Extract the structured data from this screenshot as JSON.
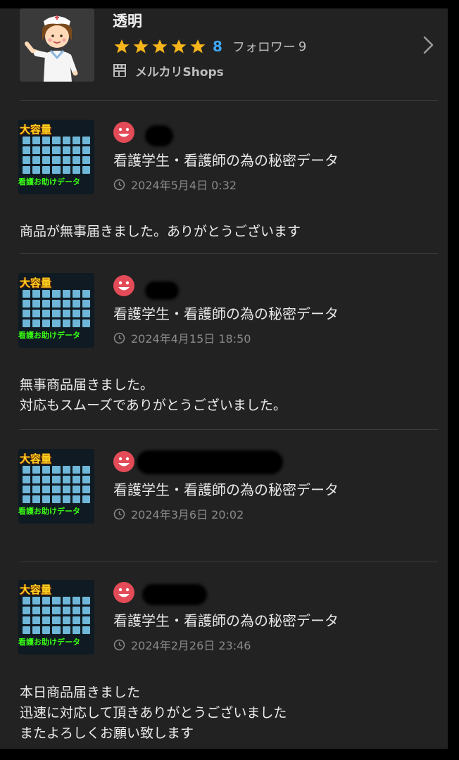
{
  "seller": {
    "name": "透明",
    "rating_count": "8",
    "follower_label": "フォロワー",
    "follower_count": "9",
    "shops_label": "メルカリShops",
    "avatar_icon": "nurse-illustration",
    "star_icon": "star-icon",
    "chevron_icon": "chevron-right-icon"
  },
  "colors": {
    "background": "#222222",
    "accent_blue": "#3da5f4",
    "star_yellow": "#f6b51b",
    "face_red": "#e24b57",
    "thumb_yellow": "#ffd21f",
    "thumb_green": "#39ff14"
  },
  "reviews": [
    {
      "thumb_title": "大容量",
      "thumb_caption": "看護お助けデータ",
      "product_title": "看護学生・看護師の為の秘密データ",
      "date": "2024年5月4日 0:32",
      "comment": [
        "商品が無事届きました。ありがとうございます"
      ]
    },
    {
      "thumb_title": "大容量",
      "thumb_caption": "看護お助けデータ",
      "product_title": "看護学生・看護師の為の秘密データ",
      "date": "2024年4月15日 18:50",
      "comment": [
        "無事商品届きました。",
        "対応もスムーズでありがとうございました。"
      ]
    },
    {
      "thumb_title": "大容量",
      "thumb_caption": "看護お助けデータ",
      "product_title": "看護学生・看護師の為の秘密データ",
      "date": "2024年3月6日 20:02",
      "comment": []
    },
    {
      "thumb_title": "大容量",
      "thumb_caption": "看護お助けデータ",
      "product_title": "看護学生・看護師の為の秘密データ",
      "date": "2024年2月26日 23:46",
      "comment": [
        "本日商品届きました",
        "迅速に対応して頂きありがとうございました",
        "またよろしくお願い致します"
      ]
    }
  ]
}
